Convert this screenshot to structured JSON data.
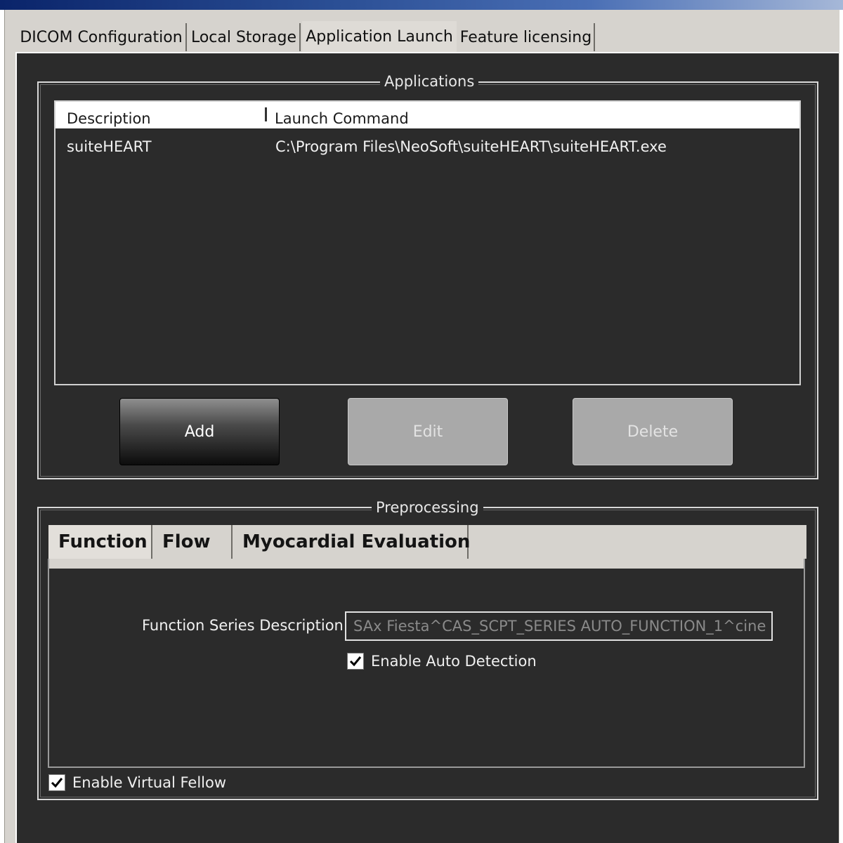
{
  "tabs": [
    {
      "label": "DICOM Configuration",
      "active": false
    },
    {
      "label": "Local Storage",
      "active": false
    },
    {
      "label": "Application Launch",
      "active": true
    },
    {
      "label": "Feature licensing",
      "active": false
    }
  ],
  "applications": {
    "title": "Applications",
    "columns": [
      "Description",
      "Launch Command"
    ],
    "rows": [
      {
        "description": "suiteHEART",
        "command": "C:\\Program Files\\NeoSoft\\suiteHEART\\suiteHEART.exe"
      }
    ],
    "buttons": {
      "add": "Add",
      "edit": "Edit",
      "delete": "Delete"
    }
  },
  "preprocessing": {
    "title": "Preprocessing",
    "tabs": [
      "Function",
      "Flow",
      "Myocardial Evaluation"
    ],
    "active_tab": "Function",
    "function_series_label": "Function Series Description",
    "function_series_value": "SAx Fiesta^CAS_SCPT_SERIES AUTO_FUNCTION_1^cine",
    "enable_auto_detection_label": "Enable Auto Detection",
    "enable_auto_detection_checked": true,
    "enable_virtual_fellow_label": "Enable Virtual Fellow",
    "enable_virtual_fellow_checked": true
  },
  "colors": {
    "panel_bg": "#2b2b2b",
    "tab_bg": "#d6d3ce",
    "button_disabled": "#a9a9a9"
  }
}
